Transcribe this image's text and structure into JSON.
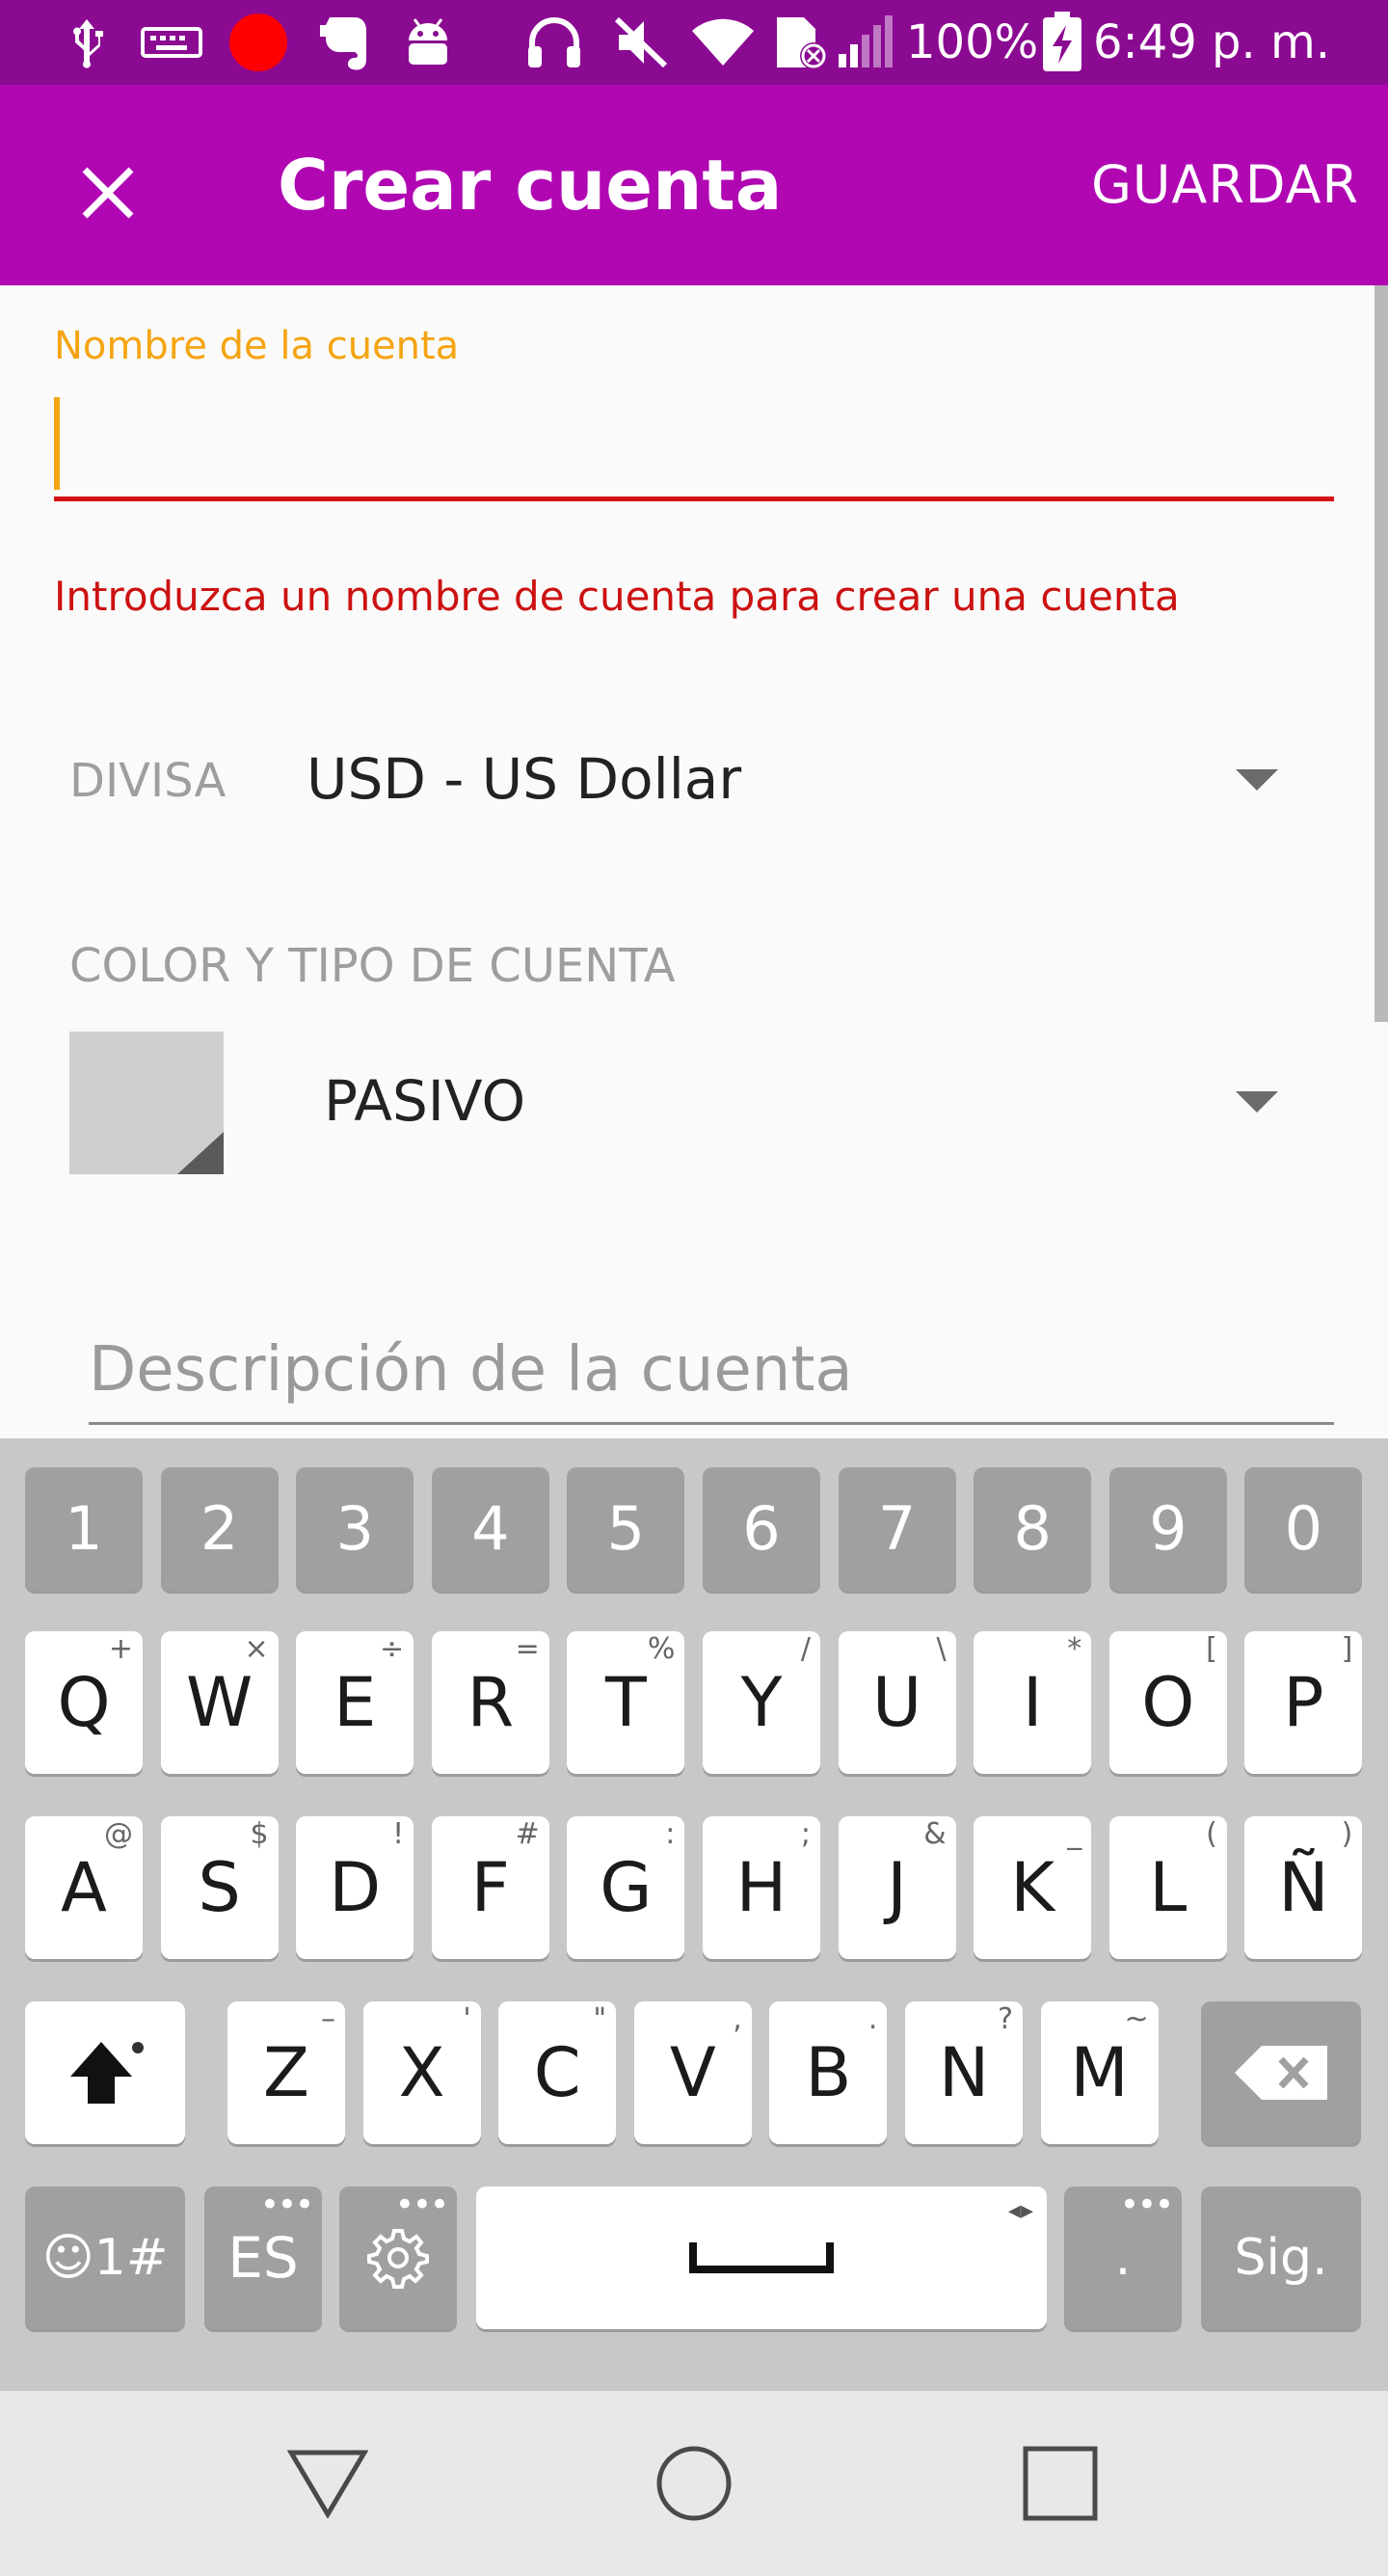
{
  "status_bar": {
    "battery": "100%",
    "time": "6:49 p. m."
  },
  "app_bar": {
    "title": "Crear cuenta",
    "save_label": "GUARDAR"
  },
  "form": {
    "name_label": "Nombre de la cuenta",
    "name_value": "",
    "name_error": "Introduzca un nombre de cuenta para crear una cuenta",
    "currency_label": "DIVISA",
    "currency_value": "USD - US Dollar",
    "color_type_label": "COLOR Y TIPO DE CUENTA",
    "account_type_value": "PASIVO",
    "description_placeholder": "Descripción de la cuenta"
  },
  "colors": {
    "status_bar": "#8b0a92",
    "app_bar": "#b007b3",
    "focus_accent": "#f5a412",
    "error": "#cc1111"
  },
  "keyboard": {
    "number_row": [
      "1",
      "2",
      "3",
      "4",
      "5",
      "6",
      "7",
      "8",
      "9",
      "0"
    ],
    "row1": [
      {
        "key": "Q",
        "hint": "+"
      },
      {
        "key": "W",
        "hint": "×"
      },
      {
        "key": "E",
        "hint": "÷"
      },
      {
        "key": "R",
        "hint": "="
      },
      {
        "key": "T",
        "hint": "%"
      },
      {
        "key": "Y",
        "hint": "/"
      },
      {
        "key": "U",
        "hint": "\\"
      },
      {
        "key": "I",
        "hint": "*"
      },
      {
        "key": "O",
        "hint": "["
      },
      {
        "key": "P",
        "hint": "]"
      }
    ],
    "row2": [
      {
        "key": "A",
        "hint": "@"
      },
      {
        "key": "S",
        "hint": "$"
      },
      {
        "key": "D",
        "hint": "!"
      },
      {
        "key": "F",
        "hint": "#"
      },
      {
        "key": "G",
        "hint": ":"
      },
      {
        "key": "H",
        "hint": ";"
      },
      {
        "key": "J",
        "hint": "&"
      },
      {
        "key": "K",
        "hint": "_"
      },
      {
        "key": "L",
        "hint": "("
      },
      {
        "key": "Ñ",
        "hint": ")"
      }
    ],
    "row3": [
      {
        "key": "Z",
        "hint": "–"
      },
      {
        "key": "X",
        "hint": "'"
      },
      {
        "key": "C",
        "hint": "\""
      },
      {
        "key": "V",
        "hint": ","
      },
      {
        "key": "B",
        "hint": "."
      },
      {
        "key": "N",
        "hint": "?"
      },
      {
        "key": "M",
        "hint": "~"
      }
    ],
    "symbols_key": "☺1#",
    "language_key": "ES",
    "period_key": ".",
    "next_key": "Sig."
  },
  "icons": {
    "close": "close-icon",
    "dropdown": "arrow-drop-down-icon",
    "shift": "shift-icon",
    "backspace": "backspace-icon",
    "settings": "gear-icon",
    "space": "space-bar-icon",
    "nav_back": "back-triangle-icon",
    "nav_home": "home-circle-icon",
    "nav_recents": "recents-square-icon"
  }
}
